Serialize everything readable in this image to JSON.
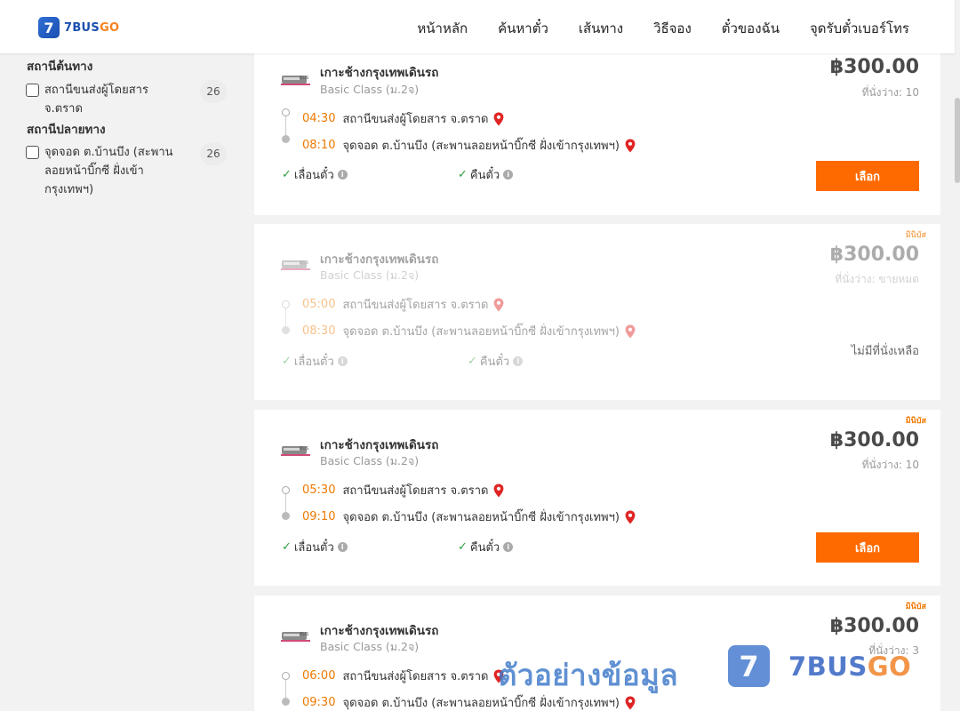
{
  "header": {
    "logo": {
      "badge": "7",
      "text_blue": "7BUS",
      "text_orange": "GO"
    },
    "nav": [
      "หน้าหลัก",
      "ค้นหาตั๋ว",
      "เส้นทาง",
      "วิธีจอง",
      "ตั๋วของฉัน",
      "จุดรับตั๋วเบอร์โทร"
    ]
  },
  "sidebar": {
    "origin_title": "สถานีต้นทาง",
    "origin_options": [
      {
        "label": "สถานีขนส่งผู้โดยสาร จ.ตราด",
        "count": "26",
        "checked": false
      }
    ],
    "dest_title": "สถานีปลายทาง",
    "dest_options": [
      {
        "label": "จุดจอด ต.บ้านบึง (สะพานลอยหน้าบิ๊กซี ฝั่งเข้ากรุงเทพฯ)",
        "count": "26",
        "checked": false
      }
    ]
  },
  "trips": [
    {
      "badge": "",
      "operator": "เกาะช้างกรุงเทพเดินรถ",
      "class": "Basic Class (ม.2จ)",
      "price": "฿300.00",
      "seats": "ที่นั่งว่าง: 10",
      "depart_time": "04:30",
      "depart_place": "สถานีขนส่งผู้โดยสาร จ.ตราด",
      "arrive_time": "08:10",
      "arrive_place": "จุดจอด ต.บ้านบึง (สะพานลอยหน้าบิ๊กซี ฝั่งเข้ากรุงเทพฯ)",
      "policy_change": "เลื่อนตั๋ว",
      "policy_refund": "คืนตั๋ว",
      "button": "เลือก",
      "available": true
    },
    {
      "badge": "มินิบัส",
      "operator": "เกาะช้างกรุงเทพเดินรถ",
      "class": "Basic Class (ม.2จ)",
      "price": "฿300.00",
      "seats": "ที่นั่งว่าง: ขายหมด",
      "depart_time": "05:00",
      "depart_place": "สถานีขนส่งผู้โดยสาร จ.ตราด",
      "arrive_time": "08:30",
      "arrive_place": "จุดจอด ต.บ้านบึง (สะพานลอยหน้าบิ๊กซี ฝั่งเข้ากรุงเทพฯ)",
      "policy_change": "เลื่อนตั๋ว",
      "policy_refund": "คืนตั๋ว",
      "status": "ไม่มีที่นั่งเหลือ",
      "available": false
    },
    {
      "badge": "มินิบัส",
      "operator": "เกาะช้างกรุงเทพเดินรถ",
      "class": "Basic Class (ม.2จ)",
      "price": "฿300.00",
      "seats": "ที่นั่งว่าง: 10",
      "depart_time": "05:30",
      "depart_place": "สถานีขนส่งผู้โดยสาร จ.ตราด",
      "arrive_time": "09:10",
      "arrive_place": "จุดจอด ต.บ้านบึง (สะพานลอยหน้าบิ๊กซี ฝั่งเข้ากรุงเทพฯ)",
      "policy_change": "เลื่อนตั๋ว",
      "policy_refund": "คืนตั๋ว",
      "button": "เลือก",
      "available": true
    },
    {
      "badge": "มินิบัส",
      "operator": "เกาะช้างกรุงเทพเดินรถ",
      "class": "Basic Class (ม.2จ)",
      "price": "฿300.00",
      "seats": "ที่นั่งว่าง: 3",
      "depart_time": "06:00",
      "depart_place": "สถานีขนส่งผู้โดยสาร จ.ตราด",
      "arrive_time": "09:30",
      "arrive_place": "จุดจอด ต.บ้านบึง (สะพานลอยหน้าบิ๊กซี ฝั่งเข้ากรุงเทพฯ)"
    }
  ],
  "watermark": {
    "text": "ตัวอย่างข้อมูล",
    "badge": "7",
    "logo_blue": "7BUS",
    "logo_orange": "GO"
  },
  "colors": {
    "accent": "#ff6a00",
    "time": "#f07800",
    "brand_blue": "#1b4fb0",
    "check": "#2e9e3f",
    "pin": "#e02424"
  },
  "icons": {
    "pin": "map-pin-icon",
    "check": "check-icon",
    "info": "info-icon",
    "bus": "bus-logo-icon"
  }
}
